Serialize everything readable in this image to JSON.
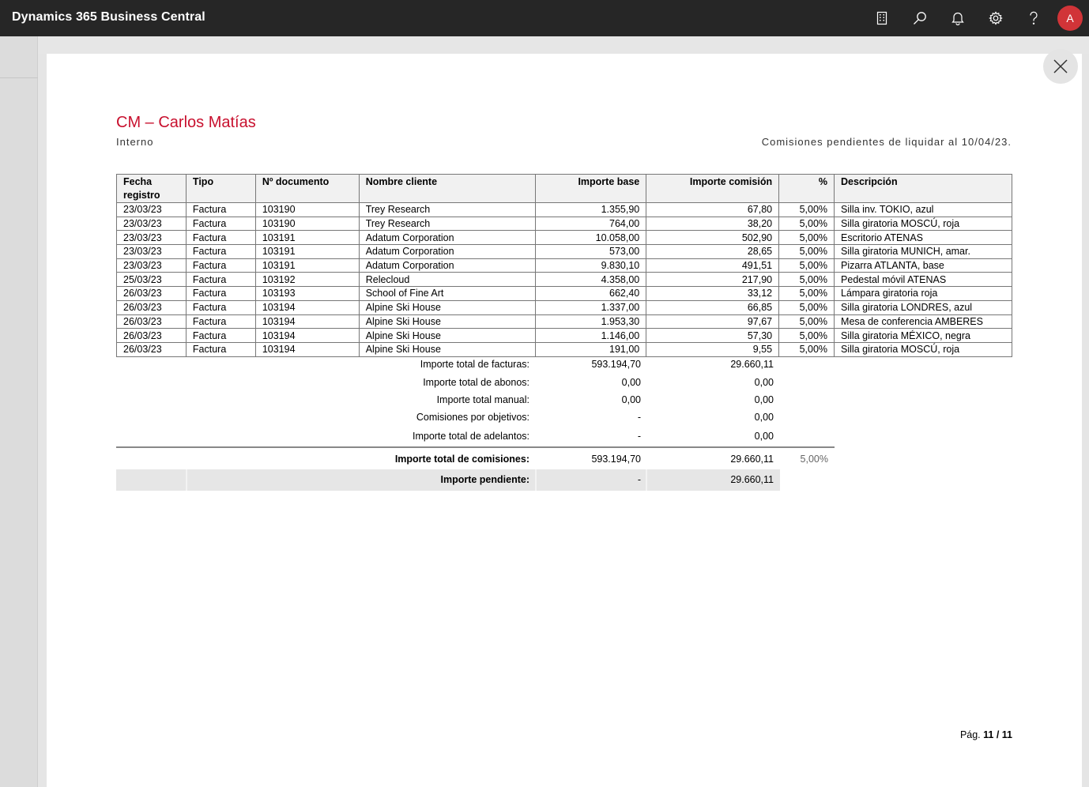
{
  "app": {
    "title": "Dynamics 365 Business Central",
    "avatar_initial": "A",
    "icons": [
      "company-icon",
      "search-icon",
      "bell-icon",
      "gear-icon",
      "help-icon"
    ],
    "accent_color": "#d13438"
  },
  "report": {
    "title": "CM – Carlos Matías",
    "subtitle": "Interno",
    "caption": "Comisiones pendientes de liquidar al 10/04/23.",
    "title_color": "#c8102e",
    "columns": {
      "fecha": "Fecha",
      "fecha2": "registro",
      "tipo": "Tipo",
      "doc": "Nº documento",
      "cliente": "Nombre cliente",
      "base": "Importe base",
      "comision": "Importe comisión",
      "pct": "%",
      "desc": "Descripción"
    },
    "rows": [
      {
        "fecha": "23/03/23",
        "tipo": "Factura",
        "doc": "103190",
        "cliente": "Trey Research",
        "base": "1.355,90",
        "comision": "67,80",
        "pct": "5,00%",
        "desc": "Silla inv. TOKIO, azul"
      },
      {
        "fecha": "23/03/23",
        "tipo": "Factura",
        "doc": "103190",
        "cliente": "Trey Research",
        "base": "764,00",
        "comision": "38,20",
        "pct": "5,00%",
        "desc": "Silla giratoria MOSCÚ, roja"
      },
      {
        "fecha": "23/03/23",
        "tipo": "Factura",
        "doc": "103191",
        "cliente": "Adatum Corporation",
        "base": "10.058,00",
        "comision": "502,90",
        "pct": "5,00%",
        "desc": "Escritorio ATENAS"
      },
      {
        "fecha": "23/03/23",
        "tipo": "Factura",
        "doc": "103191",
        "cliente": "Adatum Corporation",
        "base": "573,00",
        "comision": "28,65",
        "pct": "5,00%",
        "desc": "Silla giratoria MUNICH, amar."
      },
      {
        "fecha": "23/03/23",
        "tipo": "Factura",
        "doc": "103191",
        "cliente": "Adatum Corporation",
        "base": "9.830,10",
        "comision": "491,51",
        "pct": "5,00%",
        "desc": "Pizarra ATLANTA, base"
      },
      {
        "fecha": "25/03/23",
        "tipo": "Factura",
        "doc": "103192",
        "cliente": "Relecloud",
        "base": "4.358,00",
        "comision": "217,90",
        "pct": "5,00%",
        "desc": "Pedestal móvil ATENAS"
      },
      {
        "fecha": "26/03/23",
        "tipo": "Factura",
        "doc": "103193",
        "cliente": "School of Fine Art",
        "base": "662,40",
        "comision": "33,12",
        "pct": "5,00%",
        "desc": "Lámpara giratoria roja"
      },
      {
        "fecha": "26/03/23",
        "tipo": "Factura",
        "doc": "103194",
        "cliente": "Alpine Ski House",
        "base": "1.337,00",
        "comision": "66,85",
        "pct": "5,00%",
        "desc": "Silla giratoria LONDRES, azul"
      },
      {
        "fecha": "26/03/23",
        "tipo": "Factura",
        "doc": "103194",
        "cliente": "Alpine Ski House",
        "base": "1.953,30",
        "comision": "97,67",
        "pct": "5,00%",
        "desc": "Mesa de conferencia AMBERES"
      },
      {
        "fecha": "26/03/23",
        "tipo": "Factura",
        "doc": "103194",
        "cliente": "Alpine Ski House",
        "base": "1.146,00",
        "comision": "57,30",
        "pct": "5,00%",
        "desc": "Silla giratoria MÉXICO, negra"
      },
      {
        "fecha": "26/03/23",
        "tipo": "Factura",
        "doc": "103194",
        "cliente": "Alpine Ski House",
        "base": "191,00",
        "comision": "9,55",
        "pct": "5,00%",
        "desc": "Silla giratoria MOSCÚ, roja"
      }
    ],
    "summary": [
      {
        "label": "Importe total de facturas:",
        "base": "593.194,70",
        "comision": "29.660,11"
      },
      {
        "label": "Importe total de abonos:",
        "base": "0,00",
        "comision": "0,00"
      },
      {
        "label": "Importe total manual:",
        "base": "0,00",
        "comision": "0,00"
      },
      {
        "label": "Comisiones por objetivos:",
        "base": "-",
        "comision": "0,00"
      },
      {
        "label": "Importe total de adelantos:",
        "base": "-",
        "comision": "0,00"
      }
    ],
    "total": {
      "label": "Importe total de comisiones:",
      "base": "593.194,70",
      "comision": "29.660,11",
      "pct": "5,00%"
    },
    "pending": {
      "label": "Importe pendiente:",
      "base": "-",
      "comision": "29.660,11"
    },
    "page": {
      "prefix": "Pág.",
      "number": "11 / 11"
    }
  }
}
